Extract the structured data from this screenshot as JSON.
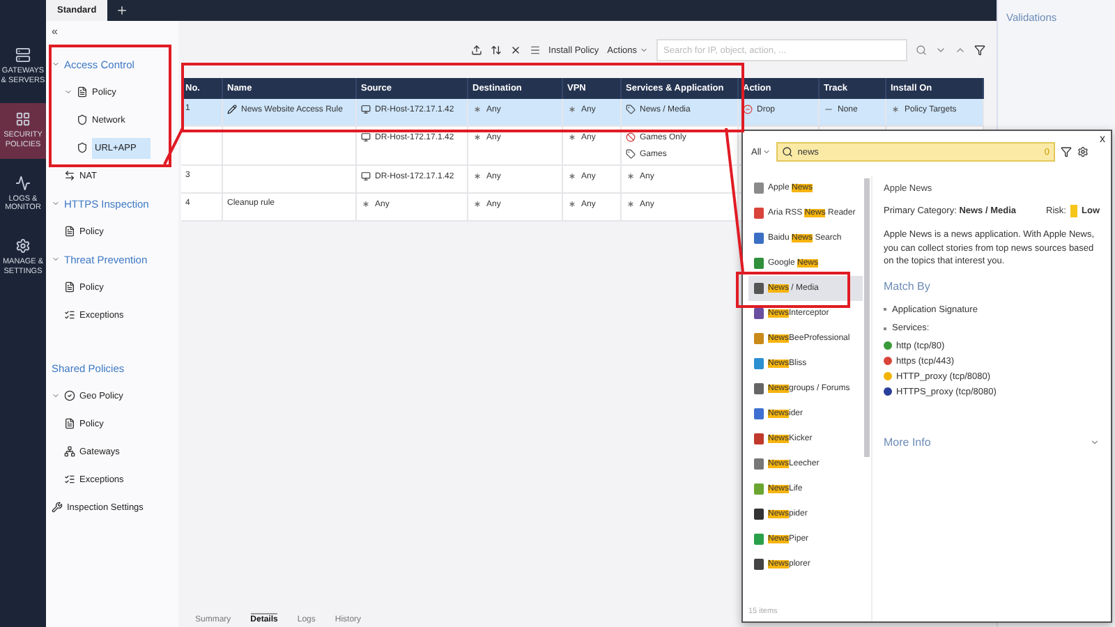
{
  "nav": [
    {
      "label": "GATEWAYS & SERVERS",
      "kind": "gateways",
      "selected": false
    },
    {
      "label": "SECURITY POLICIES",
      "kind": "policies",
      "selected": true
    },
    {
      "label": "LOGS & MONITOR",
      "kind": "logs",
      "selected": false
    },
    {
      "label": "MANAGE & SETTINGS",
      "kind": "manage",
      "selected": false
    }
  ],
  "tabs": [
    {
      "label": "Standard",
      "selected": true
    }
  ],
  "tree": {
    "collapse": "«",
    "items": [
      {
        "label": "Access Control",
        "kind": "section",
        "expanded": true,
        "children": [
          {
            "label": "Policy",
            "kind": "policy",
            "expanded": true,
            "children": [
              {
                "label": "Network",
                "kind": "network",
                "selected": false
              },
              {
                "label": "URL+APP",
                "kind": "network",
                "selected": true
              }
            ]
          },
          {
            "label": "NAT",
            "kind": "nat",
            "selected": false
          }
        ]
      },
      {
        "label": "HTTPS Inspection",
        "kind": "section",
        "expanded": true,
        "children": [
          {
            "label": "Policy",
            "kind": "policy",
            "selected": false
          }
        ]
      },
      {
        "label": "Threat Prevention",
        "kind": "section",
        "expanded": true,
        "children": [
          {
            "label": "Policy",
            "kind": "policy",
            "selected": false
          },
          {
            "label": "Exceptions",
            "kind": "exceptions",
            "selected": false
          }
        ]
      },
      {
        "label": "Shared Policies",
        "kind": "header"
      },
      {
        "label": "Geo Policy",
        "kind": "geo",
        "expanded": true,
        "children": [
          {
            "label": "Policy",
            "kind": "policy",
            "selected": false
          },
          {
            "label": "Gateways",
            "kind": "gateways",
            "selected": false
          },
          {
            "label": "Exceptions",
            "kind": "exceptions",
            "selected": false
          }
        ]
      },
      {
        "label": "Inspection Settings",
        "kind": "settings",
        "selected": false
      }
    ]
  },
  "toolbar": {
    "install": "Install Policy",
    "actions": "Actions",
    "search_placeholder": "Search for IP, object, action, ..."
  },
  "table": {
    "columns": [
      "No.",
      "Name",
      "Source",
      "Destination",
      "VPN",
      "Services & Application",
      "Action",
      "Track",
      "Install On"
    ],
    "rows": [
      {
        "selected": true,
        "cells": [
          {
            "entries": [
              {
                "text": "1"
              }
            ]
          },
          {
            "entries": [
              {
                "text": "News Website Access Rule",
                "kind": "edited"
              }
            ]
          },
          {
            "entries": [
              {
                "text": "DR-Host-172.17.1.42",
                "kind": "host"
              }
            ]
          },
          {
            "entries": [
              {
                "text": "Any",
                "kind": "any"
              }
            ]
          },
          {
            "entries": [
              {
                "text": "Any",
                "kind": "any"
              }
            ]
          },
          {
            "entries": [
              {
                "text": "News / Media",
                "kind": "category"
              }
            ]
          },
          {
            "entries": [
              {
                "text": "Drop",
                "kind": "drop"
              }
            ]
          },
          {
            "entries": [
              {
                "text": "None",
                "kind": "none"
              }
            ]
          },
          {
            "entries": [
              {
                "text": "Policy Targets",
                "kind": "any"
              }
            ]
          }
        ]
      },
      {
        "selected": false,
        "cells": [
          {},
          {},
          {
            "entries": [
              {
                "text": "DR-Host-172.17.1.42",
                "kind": "host"
              }
            ]
          },
          {
            "entries": [
              {
                "text": "Any",
                "kind": "any"
              }
            ]
          },
          {
            "entries": [
              {
                "text": "Any",
                "kind": "any"
              }
            ]
          },
          {
            "entries": [
              {
                "text": "Games Only",
                "kind": "blocked"
              },
              {
                "text": "Games",
                "kind": "category"
              }
            ]
          },
          {},
          {},
          {}
        ]
      },
      {
        "selected": false,
        "cells": [
          {
            "entries": [
              {
                "text": "3"
              }
            ]
          },
          {},
          {
            "entries": [
              {
                "text": "DR-Host-172.17.1.42",
                "kind": "host"
              }
            ]
          },
          {
            "entries": [
              {
                "text": "Any",
                "kind": "any"
              }
            ]
          },
          {
            "entries": [
              {
                "text": "Any",
                "kind": "any"
              }
            ]
          },
          {
            "entries": [
              {
                "text": "Any",
                "kind": "any"
              }
            ]
          },
          {},
          {},
          {}
        ]
      },
      {
        "selected": false,
        "cells": [
          {
            "entries": [
              {
                "text": "4"
              }
            ]
          },
          {
            "entries": [
              {
                "text": "Cleanup rule"
              }
            ]
          },
          {
            "entries": [
              {
                "text": "Any",
                "kind": "any"
              }
            ]
          },
          {
            "entries": [
              {
                "text": "Any",
                "kind": "any"
              }
            ]
          },
          {
            "entries": [
              {
                "text": "Any",
                "kind": "any"
              }
            ]
          },
          {
            "entries": [
              {
                "text": "Any",
                "kind": "any"
              }
            ]
          },
          {},
          {},
          {}
        ]
      }
    ]
  },
  "bottom_tabs": [
    {
      "label": "Summary",
      "selected": false
    },
    {
      "label": "Details",
      "selected": true
    },
    {
      "label": "Logs",
      "selected": false
    },
    {
      "label": "History",
      "selected": false
    }
  ],
  "validations": {
    "title": "Validations"
  },
  "picker": {
    "scope": "All",
    "query": "news",
    "count": "0",
    "close": "x",
    "items": [
      {
        "pre": "Apple ",
        "match": "News",
        "color": "#8a8a8a",
        "selected": false
      },
      {
        "pre": "Aria RSS ",
        "match": "News",
        "post": " Reader",
        "color": "#d9443a",
        "selected": false
      },
      {
        "pre": "Baidu ",
        "match": "News",
        "post": " Search",
        "color": "#3b6fc4",
        "selected": false
      },
      {
        "pre": "Google ",
        "match": "News",
        "color": "#2f8f3a",
        "selected": false
      },
      {
        "match": "News",
        "post": " / Media",
        "color": "#555555",
        "selected": true
      },
      {
        "match": "News",
        "post": "Interceptor",
        "color": "#6a4fa0",
        "selected": false
      },
      {
        "match": "News",
        "post": "BeeProfessional",
        "color": "#c98a1a",
        "selected": false
      },
      {
        "match": "News",
        "post": "Bliss",
        "color": "#2c8fd0",
        "selected": false
      },
      {
        "match": "News",
        "post": "groups / Forums",
        "color": "#666666",
        "selected": false
      },
      {
        "match": "News",
        "post": "ider",
        "color": "#3f6fd0",
        "selected": false
      },
      {
        "match": "News",
        "post": "Kicker",
        "color": "#c0392b",
        "selected": false
      },
      {
        "match": "News",
        "post": "Leecher",
        "color": "#777777",
        "selected": false
      },
      {
        "match": "News",
        "post": "Life",
        "color": "#6aa531",
        "selected": false
      },
      {
        "match": "News",
        "post": "pider",
        "color": "#333333",
        "selected": false
      },
      {
        "match": "News",
        "post": "Piper",
        "color": "#2aa04a",
        "selected": false
      },
      {
        "match": "News",
        "post": "plorer",
        "color": "#444444",
        "selected": false
      }
    ],
    "footer": "15 items",
    "detail": {
      "title": "Apple News",
      "category_label": "Primary Category:",
      "category": "News / Media",
      "risk_label": "Risk:",
      "risk": "Low",
      "description": "Apple News is a news application. With Apple News, you can collect stories from top news sources based on the topics that interest you.",
      "match_title": "Match By",
      "bullets": [
        "Application Signature",
        "Services:"
      ],
      "services": [
        {
          "text": "http (tcp/80)",
          "color": "#3a9a3a"
        },
        {
          "text": "https (tcp/443)",
          "color": "#d9443a"
        },
        {
          "text": "HTTP_proxy (tcp/8080)",
          "color": "#f0b400"
        },
        {
          "text": "HTTPS_proxy (tcp/8080)",
          "color": "#2a3f9a"
        }
      ],
      "more": "More Info"
    }
  }
}
